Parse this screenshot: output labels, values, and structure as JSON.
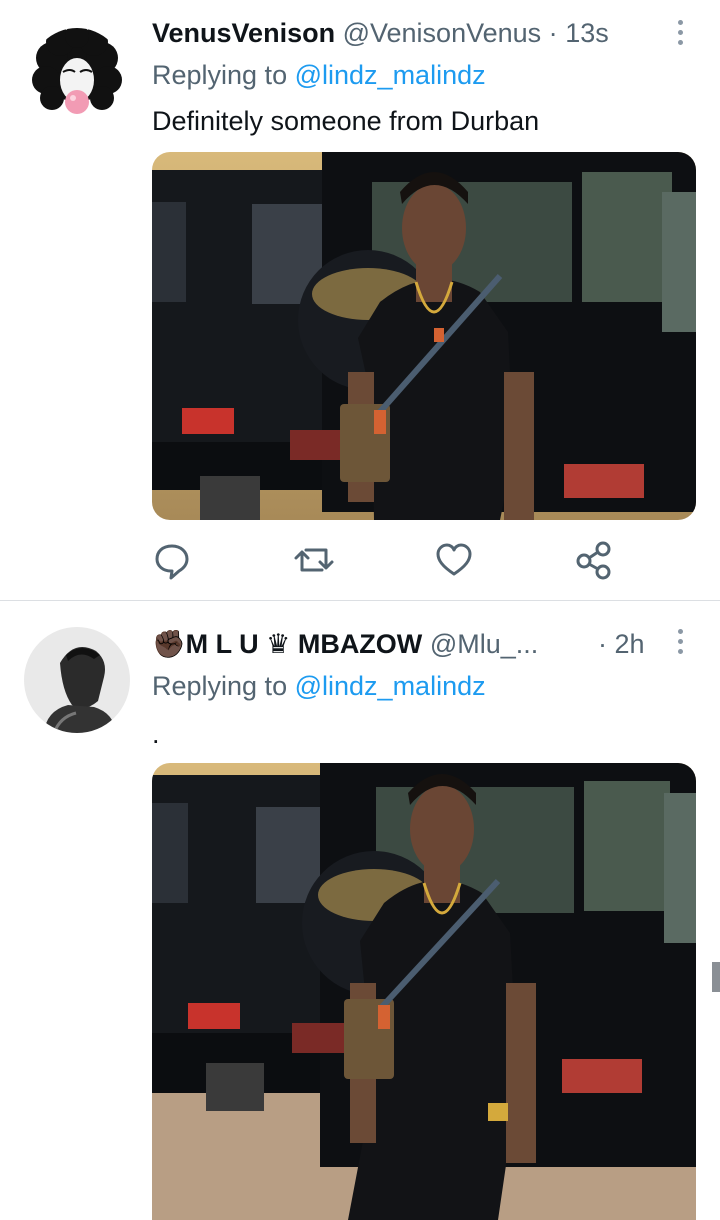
{
  "tweets": [
    {
      "display_name": "VenusVenison",
      "handle": "@VenisonVenus",
      "separator": "·",
      "time": "13s",
      "reply_prefix": "Replying to",
      "reply_to": "@lindz_malindz",
      "text": "Definitely someone from Durban",
      "actions": [
        "reply-icon",
        "retweet-icon",
        "like-icon",
        "share-icon"
      ]
    },
    {
      "display_name": "✊🏿M L U ♛ MBAZOW",
      "handle": "@Mlu_...",
      "separator": "·",
      "time": "2h",
      "reply_prefix": "Replying to",
      "reply_to": "@lindz_malindz",
      "text": "."
    }
  ],
  "colors": {
    "text": "#0f1419",
    "secondary": "#536471",
    "link": "#1d9bf0",
    "divider": "#dcdfe3"
  }
}
